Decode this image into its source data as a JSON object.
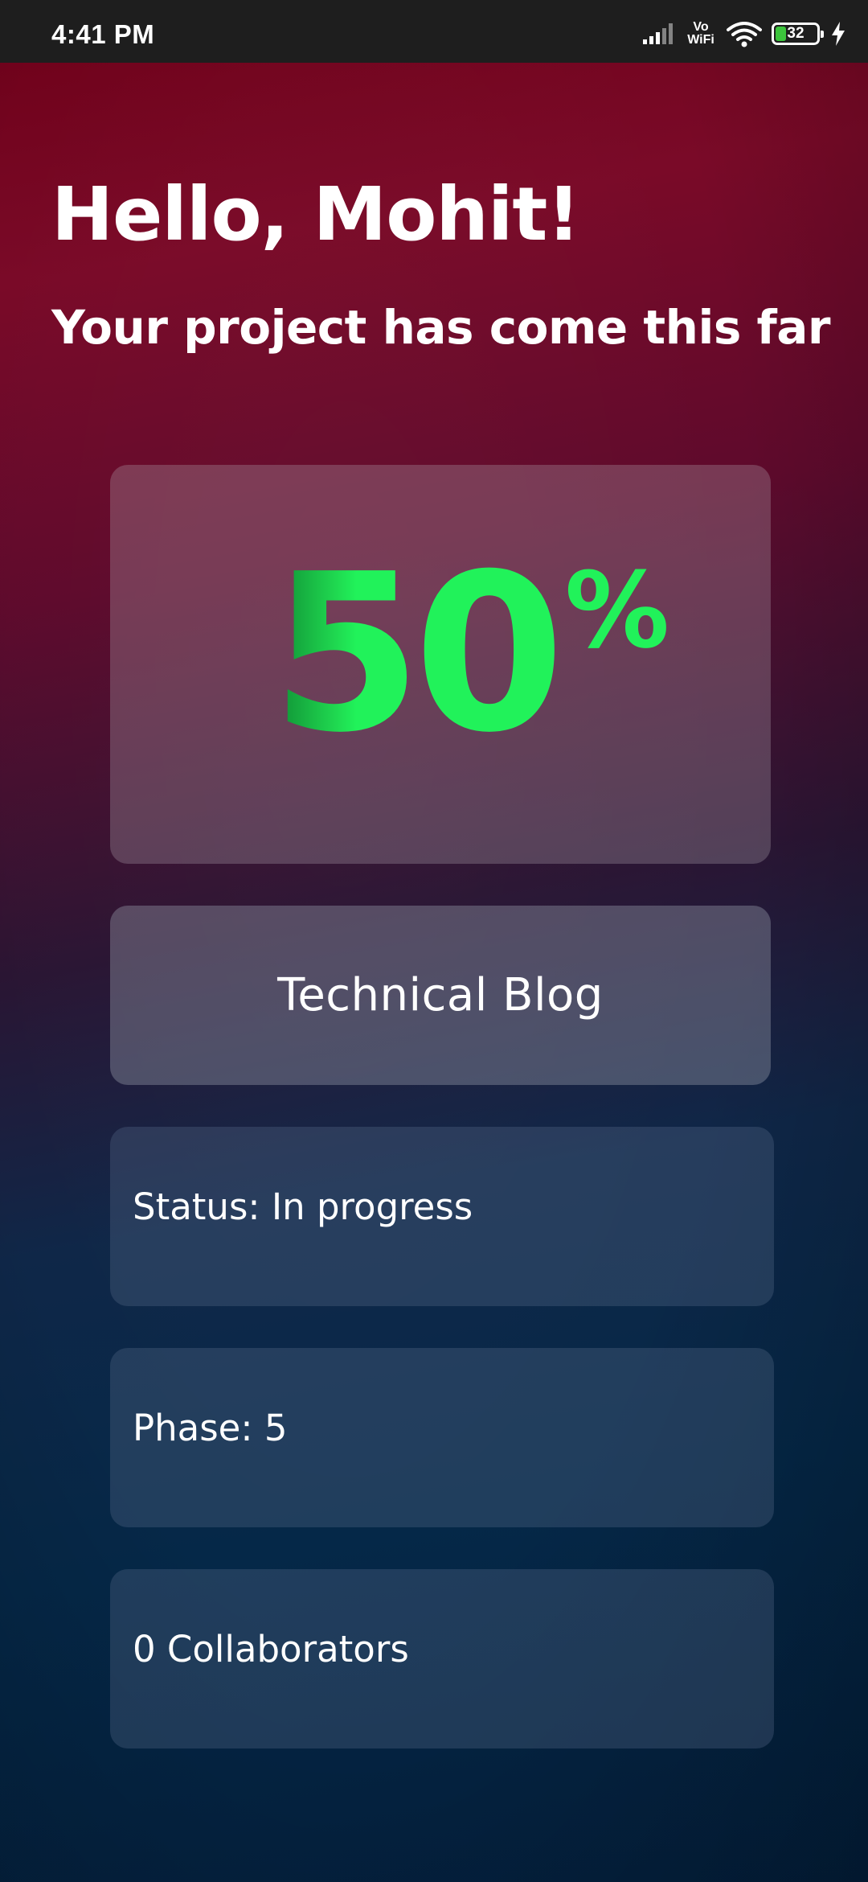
{
  "status_bar": {
    "time": "4:41 PM",
    "network_label": "Vo WiFi",
    "vowifi_top": "Vo",
    "vowifi_bottom": "WiFi",
    "battery_level": "32",
    "battery_fraction": 0.32,
    "icons": [
      "signal-icon",
      "vowifi-icon",
      "wifi-icon",
      "battery-icon",
      "charging-icon"
    ]
  },
  "header": {
    "greeting": "Hello, Mohit!",
    "subtitle": "Your project has come this far"
  },
  "progress": {
    "value": "50",
    "unit": "%",
    "percent": 50
  },
  "project": {
    "name": "Technical Blog"
  },
  "details": {
    "status": "Status: In progress",
    "phase": "Phase: 5",
    "collaborators": "0 Collaborators"
  },
  "colors": {
    "progress_green": "#21f25a",
    "top_background": "#6e0018",
    "bottom_background": "#03203e",
    "status_bar": "#1e1e1e",
    "battery_fill": "#3cc43c"
  }
}
